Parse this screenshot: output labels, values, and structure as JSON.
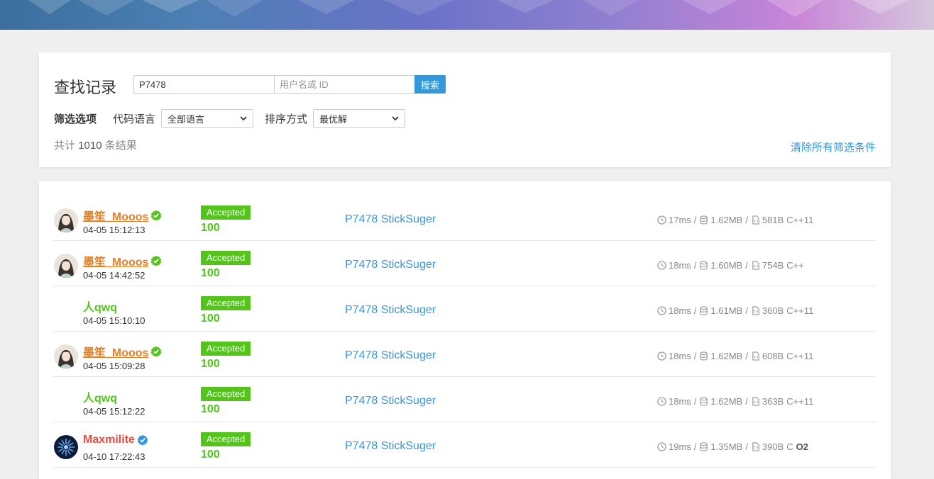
{
  "colors": {
    "accent": "#3498db",
    "accepted": "#52c41a",
    "orange_user": "#e67e22",
    "red_user": "#e74c3c"
  },
  "filter": {
    "title": "查找记录",
    "problem_input_value": "P7478",
    "user_input_placeholder": "用户名或 ID",
    "search_button": "搜索",
    "options_label": "筛选选项",
    "language_label": "代码语言",
    "language_value": "全部语言",
    "sort_label": "排序方式",
    "sort_value": "最优解",
    "total_prefix": "共计",
    "total_count": "1010",
    "total_suffix": "条结果",
    "clear_link": "清除所有筛选条件"
  },
  "records": [
    {
      "user": "墨笙_Mooos",
      "user_color": "orange",
      "verified": "green",
      "avatar": "anime-avatar",
      "time": "04-05 15:12:13",
      "status": "Accepted",
      "score": "100",
      "problem": "P7478 StickSuger",
      "time_used": "17ms",
      "memory": "1.62MB",
      "code_size": "581B",
      "lang": "C++11",
      "o2": ""
    },
    {
      "user": "墨笙_Mooos",
      "user_color": "orange",
      "verified": "green",
      "avatar": "anime-avatar",
      "time": "04-05 14:42:52",
      "status": "Accepted",
      "score": "100",
      "problem": "P7478 StickSuger",
      "time_used": "18ms",
      "memory": "1.60MB",
      "code_size": "754B",
      "lang": "C++",
      "o2": ""
    },
    {
      "user": "人qwq",
      "user_color": "green",
      "verified": "",
      "avatar": "",
      "time": "04-05 15:10:10",
      "status": "Accepted",
      "score": "100",
      "problem": "P7478 StickSuger",
      "time_used": "18ms",
      "memory": "1.61MB",
      "code_size": "360B",
      "lang": "C++11",
      "o2": ""
    },
    {
      "user": "墨笙_Mooos",
      "user_color": "orange",
      "verified": "green",
      "avatar": "anime-avatar",
      "time": "04-05 15:09:28",
      "status": "Accepted",
      "score": "100",
      "problem": "P7478 StickSuger",
      "time_used": "18ms",
      "memory": "1.62MB",
      "code_size": "608B",
      "lang": "C++11",
      "o2": ""
    },
    {
      "user": "人qwq",
      "user_color": "green",
      "verified": "",
      "avatar": "",
      "time": "04-05 15:12:22",
      "status": "Accepted",
      "score": "100",
      "problem": "P7478 StickSuger",
      "time_used": "18ms",
      "memory": "1.62MB",
      "code_size": "363B",
      "lang": "C++11",
      "o2": ""
    },
    {
      "user": "Maxmilite",
      "user_color": "red",
      "verified": "blue",
      "avatar": "blue-flower-avatar",
      "time": "04-10 17:22:43",
      "status": "Accepted",
      "score": "100",
      "problem": "P7478 StickSuger",
      "time_used": "19ms",
      "memory": "1.35MB",
      "code_size": "390B",
      "lang": "C",
      "o2": "O2"
    }
  ]
}
